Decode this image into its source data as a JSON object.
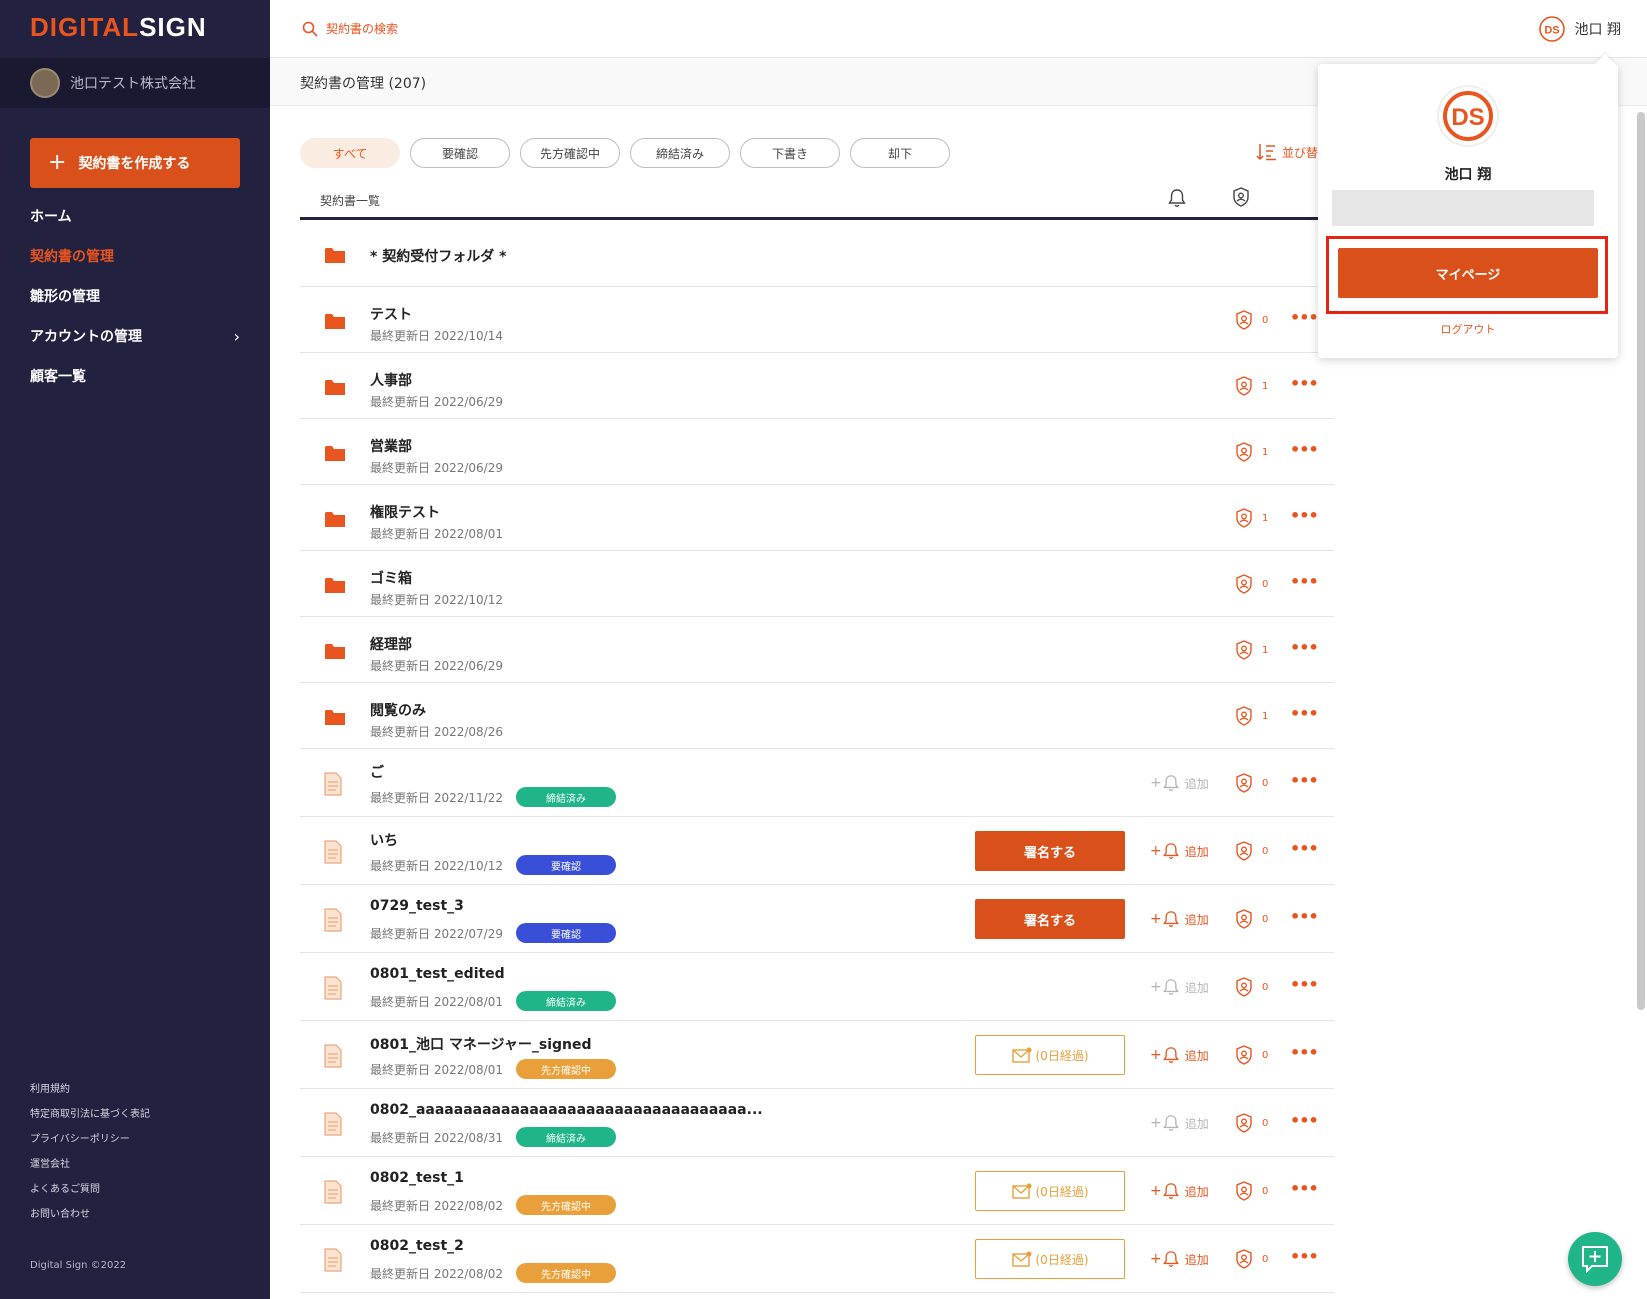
{
  "brand": {
    "logo_part1": "DIGITAL",
    "logo_part2": "SIGN"
  },
  "sidebar": {
    "company_name": "池口テスト株式会社",
    "create_button": "契約書を作成する",
    "nav": [
      {
        "label": "ホーム"
      },
      {
        "label": "契約書の管理"
      },
      {
        "label": "雛形の管理"
      },
      {
        "label": "アカウントの管理"
      },
      {
        "label": "顧客一覧"
      }
    ],
    "footer_links": [
      "利用規約",
      "特定商取引法に基づく表記",
      "プライバシーポリシー",
      "運営会社",
      "よくあるご質問",
      "お問い合わせ"
    ],
    "copyright": "Digital Sign ©2022"
  },
  "topbar": {
    "search_label": "契約書の検索",
    "user_name": "池口 翔"
  },
  "page": {
    "title": "契約書の管理 (207)"
  },
  "filters": [
    "すべて",
    "要確認",
    "先方確認中",
    "締結済み",
    "下書き",
    "却下"
  ],
  "sort_label": "並び替",
  "list": {
    "header_label": "契約書一覧",
    "rows": [
      {
        "type": "folder",
        "name": "* 契約受付フォルダ *"
      },
      {
        "type": "folder",
        "name": "テスト",
        "date": "最終更新日 2022/10/14",
        "perm_count": "0"
      },
      {
        "type": "folder",
        "name": "人事部",
        "date": "最終更新日 2022/06/29",
        "perm_count": "1"
      },
      {
        "type": "folder",
        "name": "営業部",
        "date": "最終更新日 2022/06/29",
        "perm_count": "1"
      },
      {
        "type": "folder",
        "name": "権限テスト",
        "date": "最終更新日 2022/08/01",
        "perm_count": "1"
      },
      {
        "type": "folder",
        "name": "ゴミ箱",
        "date": "最終更新日 2022/10/12",
        "perm_count": "0"
      },
      {
        "type": "folder",
        "name": "経理部",
        "date": "最終更新日 2022/06/29",
        "perm_count": "1"
      },
      {
        "type": "folder",
        "name": "閲覧のみ",
        "date": "最終更新日 2022/08/26",
        "perm_count": "1"
      },
      {
        "type": "doc",
        "name": "ご",
        "date": "最終更新日 2022/11/22",
        "badge": "締結済み",
        "add_label": "追加",
        "perm_count": "0"
      },
      {
        "type": "doc",
        "name": "いち",
        "date": "最終更新日 2022/10/12",
        "badge": "要確認",
        "action": "署名する",
        "add_label": "追加",
        "perm_count": "0"
      },
      {
        "type": "doc",
        "name": "0729_test_3",
        "date": "最終更新日 2022/07/29",
        "badge": "要確認",
        "action": "署名する",
        "add_label": "追加",
        "perm_count": "0"
      },
      {
        "type": "doc",
        "name": "0801_test_edited",
        "date": "最終更新日 2022/08/01",
        "badge": "締結済み",
        "add_label": "追加",
        "perm_count": "0"
      },
      {
        "type": "doc",
        "name": "0801_池口 マネージャー_signed",
        "date": "最終更新日 2022/08/01",
        "badge": "先方確認中",
        "reminder": "(0日経過)",
        "add_label": "追加",
        "perm_count": "0"
      },
      {
        "type": "doc",
        "name": "0802_aaaaaaaaaaaaaaaaaaaaaaaaaaaaaaaaaaa...",
        "date": "最終更新日 2022/08/31",
        "badge": "締結済み",
        "add_label": "追加",
        "perm_count": "0"
      },
      {
        "type": "doc",
        "name": "0802_test_1",
        "date": "最終更新日 2022/08/02",
        "badge": "先方確認中",
        "reminder": "(0日経過)",
        "add_label": "追加",
        "perm_count": "0"
      },
      {
        "type": "doc",
        "name": "0802_test_2",
        "date": "最終更新日 2022/08/02",
        "badge": "先方確認中",
        "reminder": "(0日経過)",
        "add_label": "追加",
        "perm_count": "0"
      }
    ]
  },
  "dropdown": {
    "name": "池口 翔",
    "mypage_button": "マイページ",
    "logout": "ログアウト"
  },
  "colors": {
    "accent": "#e9551f",
    "sidebar_bg": "#222140",
    "badge_concluded": "#1fb589",
    "badge_needs_check": "#3a4fd8",
    "badge_pending": "#e9a03a"
  }
}
